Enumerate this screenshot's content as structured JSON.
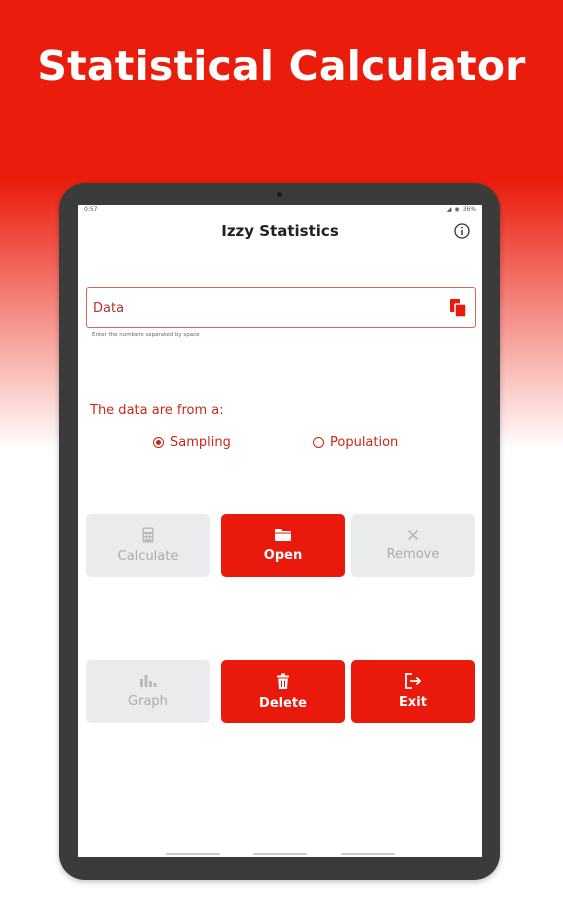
{
  "promo": {
    "title": "Statistical Calculator"
  },
  "statusbar": {
    "time": "0:57",
    "battery": "36%"
  },
  "app": {
    "title": "Izzy Statistics"
  },
  "data_field": {
    "placeholder": "Data",
    "helper": "Enter the numbers separated by space"
  },
  "source": {
    "label": "The data are from a:",
    "options": [
      {
        "label": "Sampling",
        "selected": true
      },
      {
        "label": "Population",
        "selected": false
      }
    ]
  },
  "buttons": {
    "calculate": {
      "label": "Calculate",
      "icon": "calculator-icon",
      "enabled": false
    },
    "open": {
      "label": "Open",
      "icon": "folder-open-icon",
      "enabled": true
    },
    "remove": {
      "label": "Remove",
      "icon": "close-icon",
      "enabled": false
    },
    "graph": {
      "label": "Graph",
      "icon": "bar-chart-icon",
      "enabled": false
    },
    "delete": {
      "label": "Delete",
      "icon": "trash-icon",
      "enabled": true
    },
    "exit": {
      "label": "Exit",
      "icon": "exit-icon",
      "enabled": true
    }
  },
  "colors": {
    "brand_red": "#ea1c0b",
    "button_red": "#e9190b",
    "disabled_bg": "#e9ebec",
    "disabled_text": "#a9adb0",
    "accent_text": "#c8281a"
  }
}
